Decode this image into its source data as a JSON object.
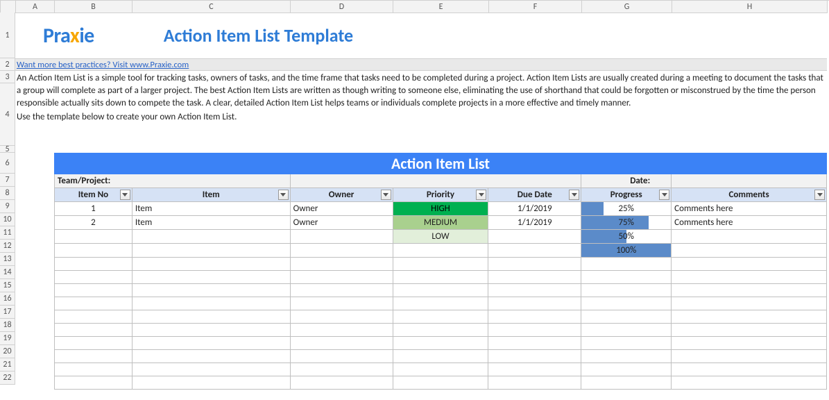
{
  "columns": [
    "A",
    "B",
    "C",
    "D",
    "E",
    "F",
    "G",
    "H"
  ],
  "visibleRows": 22,
  "logo": {
    "text": "Praxie"
  },
  "title": "Action Item List Template",
  "link": {
    "label": "Want more best practices? Visit www.Praxie.com"
  },
  "description": {
    "p1": "An Action Item List is a simple tool for tracking tasks, owners of tasks, and the time frame that tasks need to be completed during a project. Action Item Lists are usually created during a meeting to document the tasks that a group will complete as part of a larger project. The best Action Item Lists are written as though writing to someone else, eliminating the use of shorthand that could be forgotten or misconstrued by the time the person responsible actually sits down to compete the task. A clear, detailed Action Item List helps teams or individuals complete projects in a more effective and timely manner.",
    "p2": "Use the template below to create your own Action Item List."
  },
  "tableTitle": "Action Item List",
  "meta": {
    "teamLabel": "Team/Project:",
    "dateLabel": "Date:"
  },
  "headers": {
    "itemNo": "Item No",
    "item": "Item",
    "owner": "Owner",
    "priority": "Priority",
    "dueDate": "Due Date",
    "progress": "Progress",
    "comments": "Comments"
  },
  "rows": [
    {
      "itemNo": "1",
      "item": "Item",
      "owner": "Owner",
      "priority": "HIGH",
      "due": "1/1/2019",
      "progress": "25%",
      "progressPct": 25,
      "comments": "Comments here"
    },
    {
      "itemNo": "2",
      "item": "Item",
      "owner": "Owner",
      "priority": "MEDIUM",
      "due": "1/1/2019",
      "progress": "75%",
      "progressPct": 75,
      "comments": "Comments here"
    },
    {
      "itemNo": "",
      "item": "",
      "owner": "",
      "priority": "LOW",
      "due": "",
      "progress": "50%",
      "progressPct": 50,
      "comments": ""
    },
    {
      "itemNo": "",
      "item": "",
      "owner": "",
      "priority": "",
      "due": "",
      "progress": "100%",
      "progressPct": 100,
      "comments": ""
    }
  ],
  "emptyRowCount": 10,
  "rowHeights": {
    "1": 66,
    "2": 18,
    "3": 18,
    "4": 90,
    "5": 10,
    "6": 30
  }
}
